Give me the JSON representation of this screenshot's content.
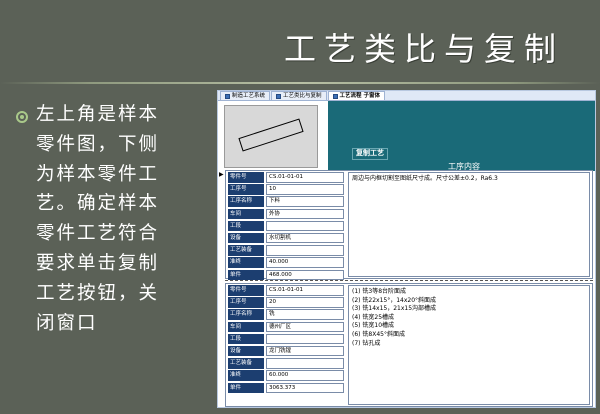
{
  "slide": {
    "title": "工艺类比与复制",
    "bullet_text": "左上角是样本零件图，下侧为样本零件工艺。确定样本零件工艺符合要求单击复制工艺按钮，关闭窗口",
    "accent_color": "#a9c98a",
    "bullet_icon": "bullet-circle-icon"
  },
  "app": {
    "tabs": [
      {
        "label": "制造工艺系统"
      },
      {
        "label": "工艺类比与复制"
      },
      {
        "label": "工艺流程 子窗体"
      }
    ],
    "copy_button_label": "复制工艺",
    "content_label": "工序内容",
    "record_indicator": "▶",
    "field_labels": [
      "零件号",
      "工序号",
      "工序名称",
      "车间",
      "工段",
      "设备",
      "工艺装备",
      "准终",
      "单件"
    ],
    "records": [
      {
        "values": [
          "CS.01-01-01",
          "10",
          "下料",
          "外协",
          "",
          "水切割机",
          "",
          "40.000",
          "468.000"
        ],
        "content": "周边与内框切割至图纸尺寸成。尺寸公差±0.2，Ra6.3"
      },
      {
        "values": [
          "CS.01-01-01",
          "20",
          "铣",
          "德州厂区",
          "",
          "龙门铣镗",
          "",
          "60.000",
          "3063.373"
        ],
        "content": "(1) 铣3等8台阶面成\n(2) 铣22x15°，14x20°斜面成\n(3) 铣14x15，21x15沟部槽成\n(4) 铣宽25槽成\n(5) 铣宽10槽成\n(6) 铣8X45°斜面成\n(7) 钻孔成"
      }
    ]
  }
}
